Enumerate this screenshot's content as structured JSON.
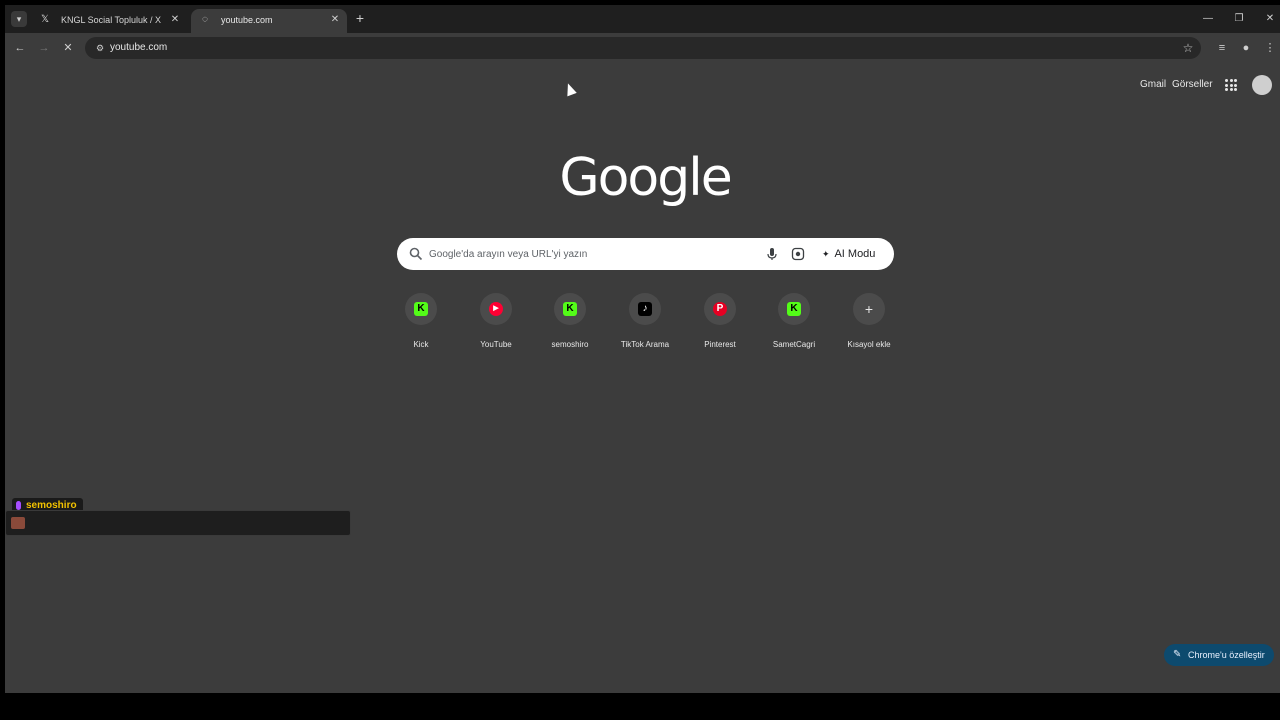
{
  "tabs": [
    {
      "title": "KNGL Social Topluluk / X",
      "icon": "x-logo-icon"
    },
    {
      "title": "youtube.com",
      "icon": "loading-icon"
    }
  ],
  "toolbar": {
    "url": "youtube.com"
  },
  "google": {
    "logo": "Google",
    "links": {
      "gmail": "Gmail",
      "images": "Görseller"
    },
    "search_placeholder": "Google'da arayın veya URL'yi yazın",
    "ai_mode": "AI Modu"
  },
  "shortcuts": [
    {
      "label": "Kick",
      "glyph": "K"
    },
    {
      "label": "YouTube",
      "glyph": "▶"
    },
    {
      "label": "semoshiro",
      "glyph": "K"
    },
    {
      "label": "TikTok Arama",
      "glyph": "♪"
    },
    {
      "label": "Pinterest",
      "glyph": "P"
    },
    {
      "label": "SametCagri",
      "glyph": "K"
    },
    {
      "label": "Kısayol ekle",
      "glyph": "+"
    }
  ],
  "overlay": {
    "username": "semoshiro"
  },
  "customize_label": "Chrome'u özelleştir",
  "colors": {
    "page_bg": "#3c3c3c",
    "tabstrip_bg": "#1f1f1f",
    "kick_green": "#53fc18",
    "customize_bg": "#0d4a6e"
  }
}
